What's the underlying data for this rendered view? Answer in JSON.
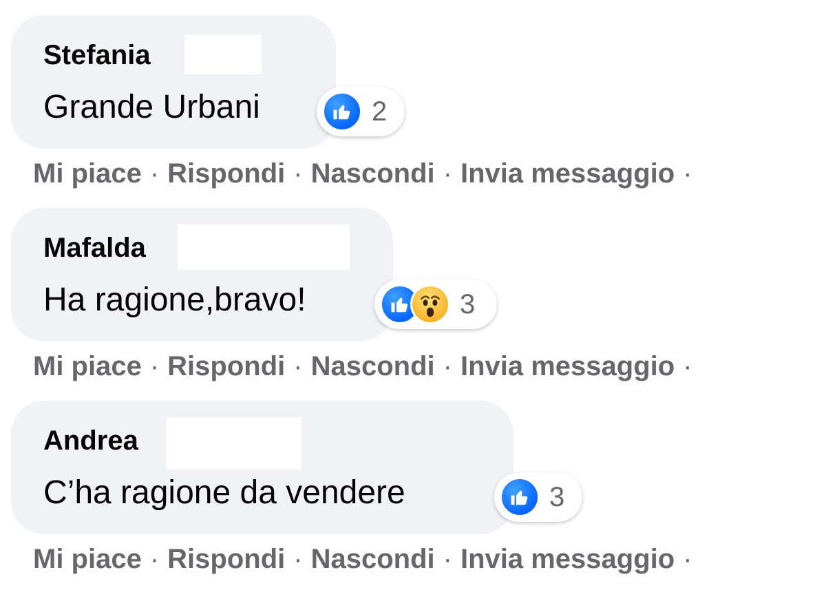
{
  "colors": {
    "bubble_bg": "#f0f2f5",
    "text_primary": "#050505",
    "text_secondary": "#65676b",
    "like_blue": "#0866ff",
    "wow_yellow": "#f7b125"
  },
  "actions": {
    "like": "Mi piace",
    "reply": "Rispondi",
    "hide": "Nascondi",
    "message": "Invia messaggio",
    "separator": "·"
  },
  "comments": [
    {
      "author": "Stefania",
      "text": "Grande Urbani",
      "reactions": [
        "like-icon"
      ],
      "reaction_count": "2"
    },
    {
      "author": "Mafalda",
      "text": "Ha ragione,bravo!",
      "reactions": [
        "like-icon",
        "wow-icon"
      ],
      "reaction_count": "3"
    },
    {
      "author": "Andrea",
      "text": "C’ha ragione da vendere",
      "reactions": [
        "like-icon"
      ],
      "reaction_count": "3"
    }
  ]
}
